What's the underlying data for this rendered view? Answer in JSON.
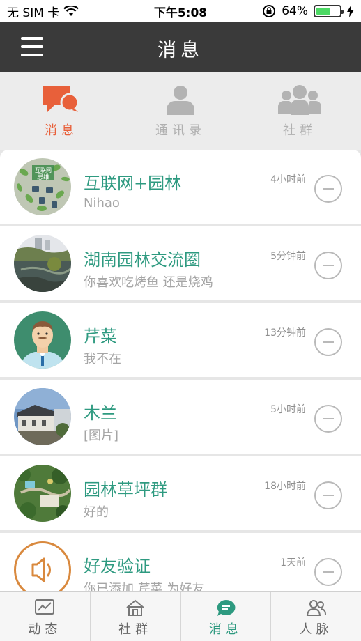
{
  "status": {
    "carrier": "无 SIM 卡",
    "time": "下午5:08",
    "battery_percent": "64%",
    "battery_level": 0.64
  },
  "header": {
    "title": "消息"
  },
  "tabs": [
    {
      "label": "消息",
      "icon": "chat-bubbles-icon",
      "active": true
    },
    {
      "label": "通讯录",
      "icon": "person-icon",
      "active": false
    },
    {
      "label": "社群",
      "icon": "group-icon",
      "active": false
    }
  ],
  "conversations": [
    {
      "name": "互联网+园林",
      "last_message": "Nihao",
      "time": "4小时前",
      "avatar": "internet-thinking-avatar"
    },
    {
      "name": "湖南园林交流圈",
      "last_message": "你喜欢吃烤鱼 还是烧鸡",
      "time": "5分钟前",
      "avatar": "lake-landscape-avatar"
    },
    {
      "name": "芹菜",
      "last_message": "我不在",
      "time": "13分钟前",
      "avatar": "man-cartoon-avatar"
    },
    {
      "name": "木兰",
      "last_message": "[图片]",
      "time": "5小时前",
      "avatar": "building-photo-avatar"
    },
    {
      "name": "园林草坪群",
      "last_message": "好的",
      "time": "18小时前",
      "avatar": "garden-aerial-avatar"
    },
    {
      "name": "好友验证",
      "last_message": "你已添加 芹菜 为好友",
      "time": "1天前",
      "avatar": "speaker-icon"
    }
  ],
  "bottom_nav": [
    {
      "label": "动态",
      "icon": "activity-icon",
      "active": false
    },
    {
      "label": "社群",
      "icon": "house-icon",
      "active": false
    },
    {
      "label": "消息",
      "icon": "message-bubble-icon",
      "active": true
    },
    {
      "label": "人脉",
      "icon": "contacts-icon",
      "active": false
    }
  ],
  "colors": {
    "accent_orange": "#e8603a",
    "accent_green": "#2e9a80",
    "header_bg": "#3a3a3a"
  }
}
